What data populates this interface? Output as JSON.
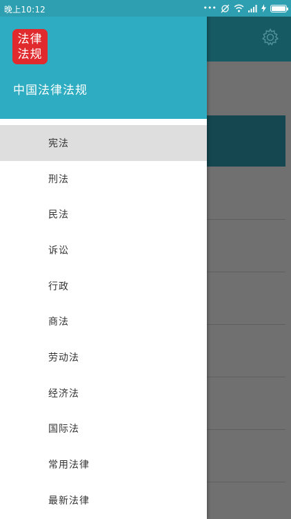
{
  "status_bar": {
    "time": "晚上10:12",
    "battery_level": 1.0
  },
  "drawer": {
    "logo_line1": "法律",
    "logo_line2": "法规",
    "app_title": "中国法律法规",
    "menu_items": [
      {
        "label": "宪法",
        "selected": true
      },
      {
        "label": "刑法",
        "selected": false
      },
      {
        "label": "民法",
        "selected": false
      },
      {
        "label": "诉讼",
        "selected": false
      },
      {
        "label": "行政",
        "selected": false
      },
      {
        "label": "商法",
        "selected": false
      },
      {
        "label": "劳动法",
        "selected": false
      },
      {
        "label": "经济法",
        "selected": false
      },
      {
        "label": "国际法",
        "selected": false
      },
      {
        "label": "常用法律",
        "selected": false
      },
      {
        "label": "最新法律",
        "selected": false
      }
    ]
  },
  "main": {
    "settings_icon": "gear-icon"
  },
  "colors": {
    "header_bg": "#2eacc2",
    "logo_bg": "#e12a2e",
    "selected_bg": "#dedede",
    "app_bar_dimmed": "#165a64"
  }
}
